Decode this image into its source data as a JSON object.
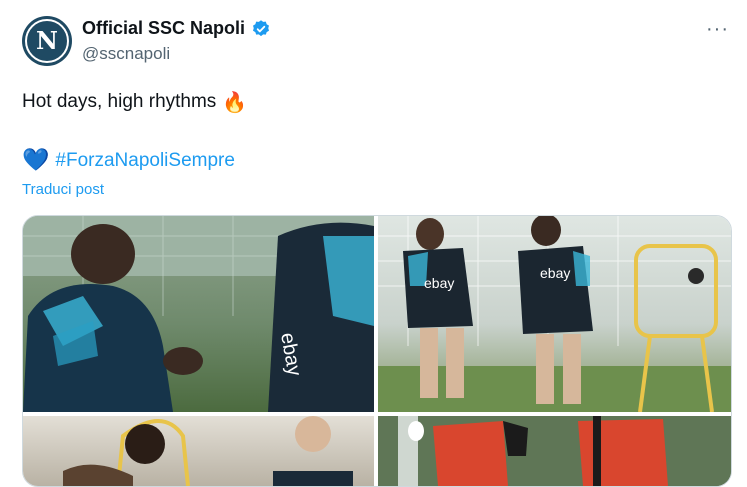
{
  "tweet": {
    "author_name": "Official SSC Napoli",
    "handle": "@sscnapoli",
    "avatar_letter": "N",
    "text": "Hot days, high rhythms",
    "hashtag": "#ForzaNapoliSempre",
    "translate_label": "Traduci post",
    "more_label": "···"
  },
  "icons": {
    "verified": "verified-badge-icon",
    "fire": "fire-emoji",
    "heart": "blue-heart-emoji",
    "more": "more-options-icon"
  },
  "colors": {
    "accent": "#1d9bf0",
    "text": "#0f1419",
    "muted": "#536471",
    "border": "#cfd9de"
  },
  "photos": [
    {
      "name": "photo-handshake",
      "sponsor": "ebay"
    },
    {
      "name": "photo-two-players-training",
      "sponsor": "ebay"
    },
    {
      "name": "photo-players-with-equipment"
    },
    {
      "name": "photo-goalkeepers"
    }
  ]
}
